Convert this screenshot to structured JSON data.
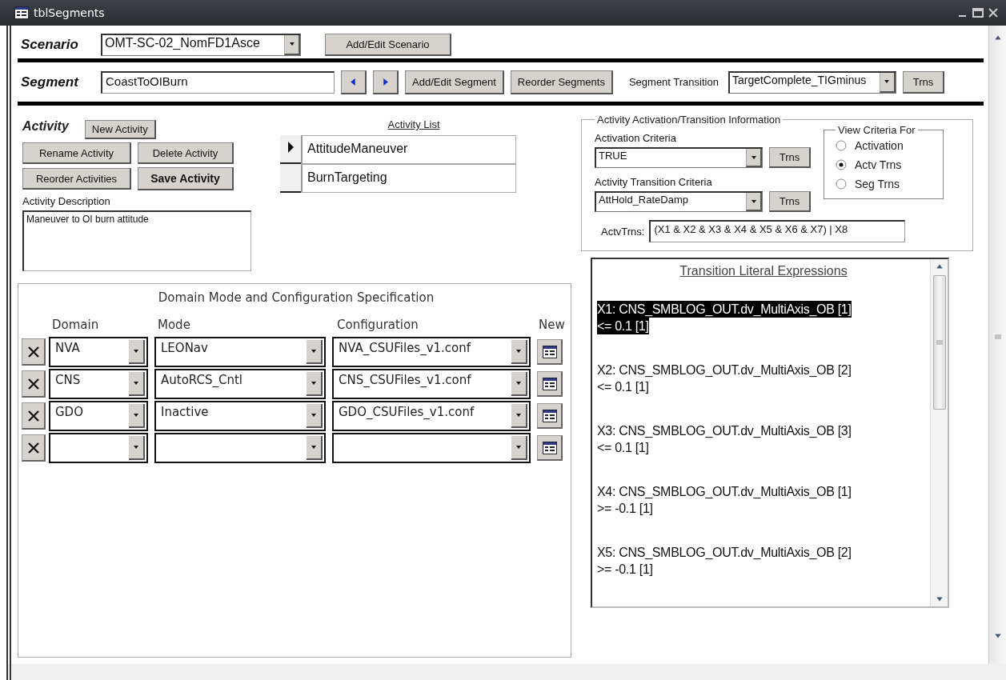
{
  "window": {
    "title": "tblSegments"
  },
  "scenario": {
    "label": "Scenario",
    "value": "OMT-SC-02_NomFD1Asce",
    "button": "Add/Edit Scenario"
  },
  "segment": {
    "label": "Segment",
    "value": "CoastToOIBurn",
    "buttons": [
      "Add/Edit Segment",
      "Reorder Segments"
    ],
    "transition_label": "Segment Transition",
    "transition_value": "TargetComplete_TIGminus",
    "transition_button": "Trns"
  },
  "activity": {
    "title": "Activity",
    "buttons": [
      "New Activity",
      "Rename Activity",
      "Delete Activity",
      "Reorder Activities",
      "Save Activity"
    ],
    "description_label": "Activity Description",
    "description": "Maneuver to OI burn attitude",
    "list_title": "Activity List",
    "list": [
      {
        "name": "AttitudeManeuver",
        "selected": true
      },
      {
        "name": "BurnTargeting",
        "selected": false
      }
    ]
  },
  "domain_spec": {
    "title": "Domain Mode and Configuration Specification",
    "columns": [
      "Domain",
      "Mode",
      "Configuration",
      "New"
    ],
    "rows": [
      {
        "domain": "NVA",
        "mode": "LEONav",
        "configuration": "NVA_CSUFiles_v1.conf"
      },
      {
        "domain": "CNS",
        "mode": "AutoRCS_Cntl",
        "configuration": "CNS_CSUFiles_v1.conf"
      },
      {
        "domain": "GDO",
        "mode": "Inactive",
        "configuration": "GDO_CSUFiles_v1.conf"
      },
      {}
    ]
  },
  "activation": {
    "title": "Activity Activation/Transition Information",
    "activation_label": "Activation Criteria",
    "activation_value": "TRUE",
    "activation_button": "Trns",
    "transition_label": "Activity Transition Criteria",
    "transition_value": "AttHold_RateDamp",
    "transition_button": "Trns",
    "view_title": "View Criteria For",
    "view_options": [
      {
        "label": "Activation",
        "selected": false
      },
      {
        "label": "Actv Trns",
        "selected": true
      },
      {
        "label": "Seg Trns",
        "selected": false
      }
    ],
    "expr_label": "ActvTrns:",
    "expr_value": "(X1 & X2 & X3 & X4 & X5 & X6 & X7) | X8"
  },
  "literals": {
    "title": "Transition Literal Expressions",
    "items": [
      {
        "text": "X1: CNS_SMBLOG_OUT.dv_MultiAxis_OB [1]",
        "condition": "<= 0.1 [1]",
        "selected": true
      },
      {
        "text": "X2: CNS_SMBLOG_OUT.dv_MultiAxis_OB [2]",
        "condition": "<= 0.1 [1]",
        "selected": false
      },
      {
        "text": "X3: CNS_SMBLOG_OUT.dv_MultiAxis_OB [3]",
        "condition": "<= 0.1 [1]",
        "selected": false
      },
      {
        "text": "X4: CNS_SMBLOG_OUT.dv_MultiAxis_OB [1]",
        "condition": ">= -0.1 [1]",
        "selected": false
      },
      {
        "text": "X5: CNS_SMBLOG_OUT.dv_MultiAxis_OB [2]",
        "condition": ">= -0.1 [1]",
        "selected": false
      }
    ]
  }
}
